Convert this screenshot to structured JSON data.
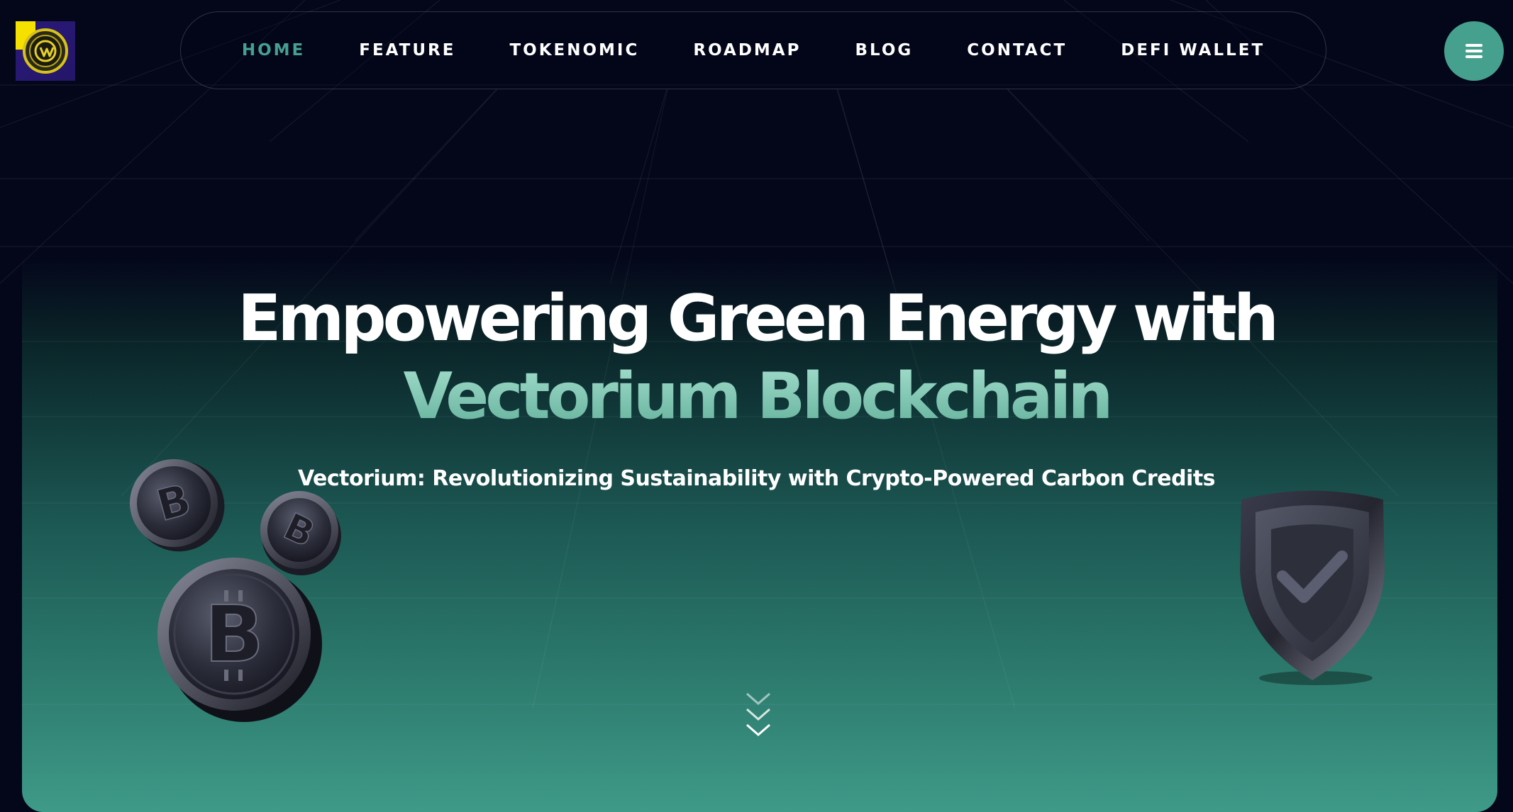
{
  "brand": {
    "logo_icon": "coin-logo-icon",
    "accent_color": "#46a08e"
  },
  "nav": {
    "items": [
      {
        "label": "HOME",
        "active": true
      },
      {
        "label": "FEATURE",
        "active": false
      },
      {
        "label": "TOKENOMIC",
        "active": false
      },
      {
        "label": "ROADMAP",
        "active": false
      },
      {
        "label": "BLOG",
        "active": false
      },
      {
        "label": "CONTACT",
        "active": false
      },
      {
        "label": "DEFI WALLET",
        "active": false
      }
    ],
    "menu_icon": "hamburger-icon"
  },
  "hero": {
    "headline_line1": "Empowering Green Energy with",
    "headline_line2": "Vectorium Blockchain",
    "subtitle": "Vectorium: Revolutionizing Sustainability with Crypto-Powered Carbon Credits",
    "left_graphic": "bitcoin-coins-icon",
    "right_graphic": "shield-check-icon",
    "scroll_icon": "chevrons-down-icon"
  },
  "colors": {
    "background": "#04061a",
    "accent_text": "#7fc8b4",
    "active_nav": "#45a090"
  }
}
